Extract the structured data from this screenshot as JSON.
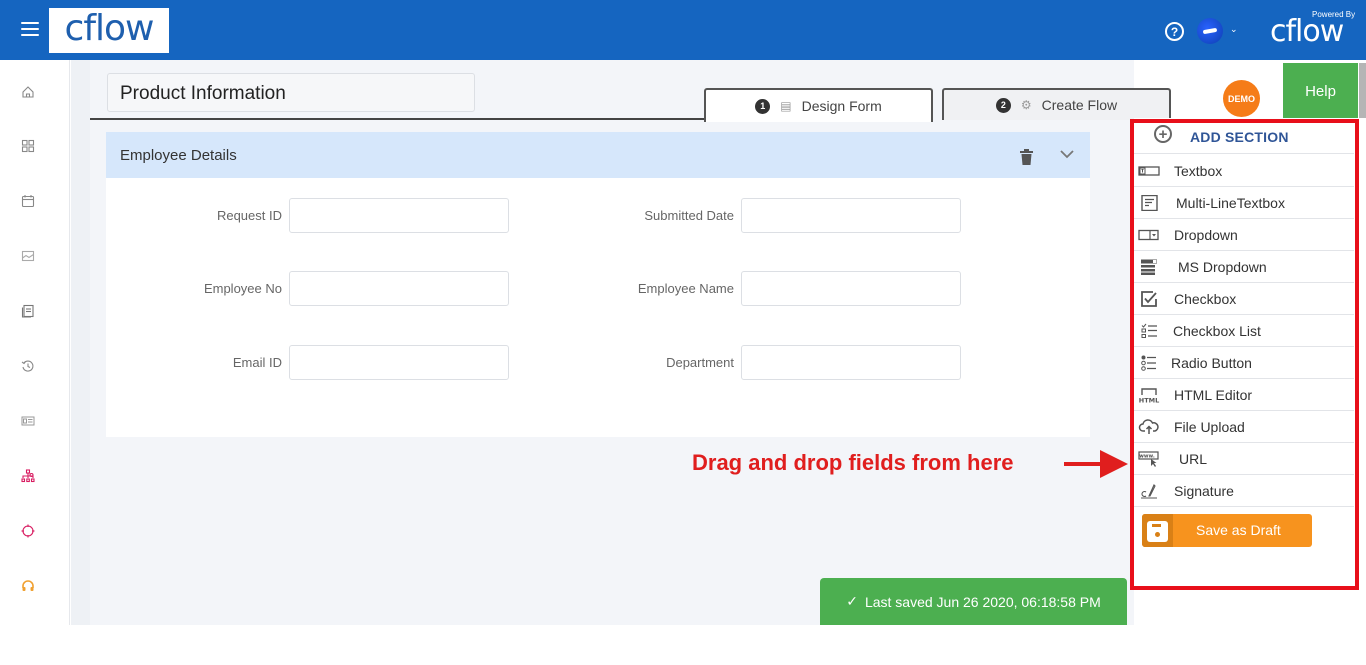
{
  "header": {
    "brand_logo": "cflow",
    "powered_by_label": "Powered By",
    "powered_by_logo": "cflow",
    "help_icon_glyph": "?",
    "avatar_caret_glyph": "⌄"
  },
  "sidebar": {
    "items": [
      {
        "icon": "home-icon"
      },
      {
        "icon": "apps-grid-icon"
      },
      {
        "icon": "calendar-icon"
      },
      {
        "icon": "image-report-icon"
      },
      {
        "icon": "document-icon"
      },
      {
        "icon": "history-icon"
      },
      {
        "icon": "id-card-icon"
      },
      {
        "icon": "workflow-hierarchy-icon",
        "color": "#d81b60"
      },
      {
        "icon": "target-icon",
        "color": "#d81b60"
      },
      {
        "icon": "headset-support-icon",
        "color": "#f0a030"
      }
    ]
  },
  "form": {
    "name_value": "Product Information"
  },
  "tabs": [
    {
      "number": "1",
      "label": "Design Form",
      "active": true
    },
    {
      "number": "2",
      "label": "Create Flow",
      "active": false
    }
  ],
  "badges": {
    "demo_label": "DEMO"
  },
  "help_button_label": "Help",
  "section": {
    "title": "Employee Details",
    "fields": [
      {
        "label": "Request ID",
        "value": ""
      },
      {
        "label": "Submitted Date",
        "value": ""
      },
      {
        "label": "Employee No",
        "value": ""
      },
      {
        "label": "Employee Name",
        "value": ""
      },
      {
        "label": "Email ID",
        "value": ""
      },
      {
        "label": "Department",
        "value": ""
      }
    ]
  },
  "palette": {
    "add_section_label": "ADD SECTION",
    "items": [
      {
        "label": "Textbox",
        "icon": "textbox-icon"
      },
      {
        "label": "Multi-LineTextbox",
        "icon": "multiline-textbox-icon"
      },
      {
        "label": "Dropdown",
        "icon": "dropdown-icon"
      },
      {
        "label": "MS Dropdown",
        "icon": "multi-select-dropdown-icon"
      },
      {
        "label": "Checkbox",
        "icon": "checkbox-icon"
      },
      {
        "label": "Checkbox List",
        "icon": "checkbox-list-icon"
      },
      {
        "label": "Radio Button",
        "icon": "radio-button-icon"
      },
      {
        "label": "HTML Editor",
        "icon": "html-editor-icon"
      },
      {
        "label": "File Upload",
        "icon": "file-upload-icon"
      },
      {
        "label": "URL",
        "icon": "url-icon"
      },
      {
        "label": "Signature",
        "icon": "signature-icon"
      }
    ],
    "save_draft_label": "Save as Draft"
  },
  "annotation": {
    "callout_text": "Drag and drop fields from here"
  },
  "toast": {
    "check_glyph": "✓",
    "message": "Last saved Jun 26 2020, 06:18:58 PM"
  },
  "colors": {
    "topbar": "#1565c0",
    "help_green": "#4caf50",
    "demo_orange": "#f57c18",
    "draft_orange": "#f7931e",
    "annotation_red": "#e01e1e",
    "section_header": "#d6e7fb"
  }
}
